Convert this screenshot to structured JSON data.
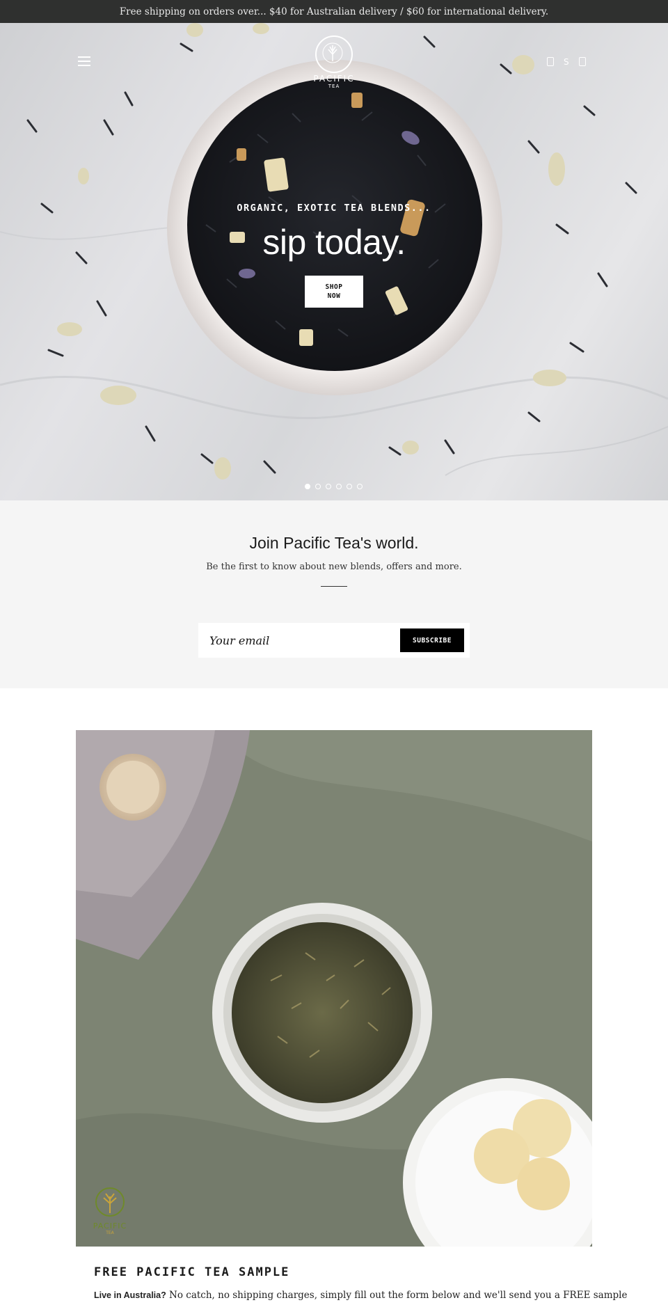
{
  "announcement": "Free shipping on orders over... $40 for Australian delivery / $60 for international delivery.",
  "header": {
    "logo_name": "PACIFIC",
    "logo_sub": "TEA",
    "account_label": "",
    "search_label": "S",
    "cart_label": ""
  },
  "hero": {
    "kicker": "ORGANIC, EXOTIC TEA BLENDS...",
    "title": "sip today.",
    "button_line1": "SHOP",
    "button_line2": "NOW",
    "slide_count": 6,
    "active_slide": 1
  },
  "newsletter": {
    "title": "Join Pacific Tea's world.",
    "subtitle": "Be the first to know about new blends, offers and more.",
    "email_placeholder": "Your email",
    "subscribe_label": "SUBSCRIBE"
  },
  "feature": {
    "logo_name": "PACIFIC",
    "logo_sub": "TEA"
  },
  "sample": {
    "title": "FREE PACIFIC TEA SAMPLE",
    "lead": "Live in Australia?",
    "text": " No catch, no shipping charges, simply fill out the form below and we'll send you a FREE sample"
  },
  "colors": {
    "announcement_bg": "#2f302f",
    "newsletter_bg": "#f5f5f5",
    "button_dark": "#000000",
    "feature_green": "#6f8a2a"
  }
}
